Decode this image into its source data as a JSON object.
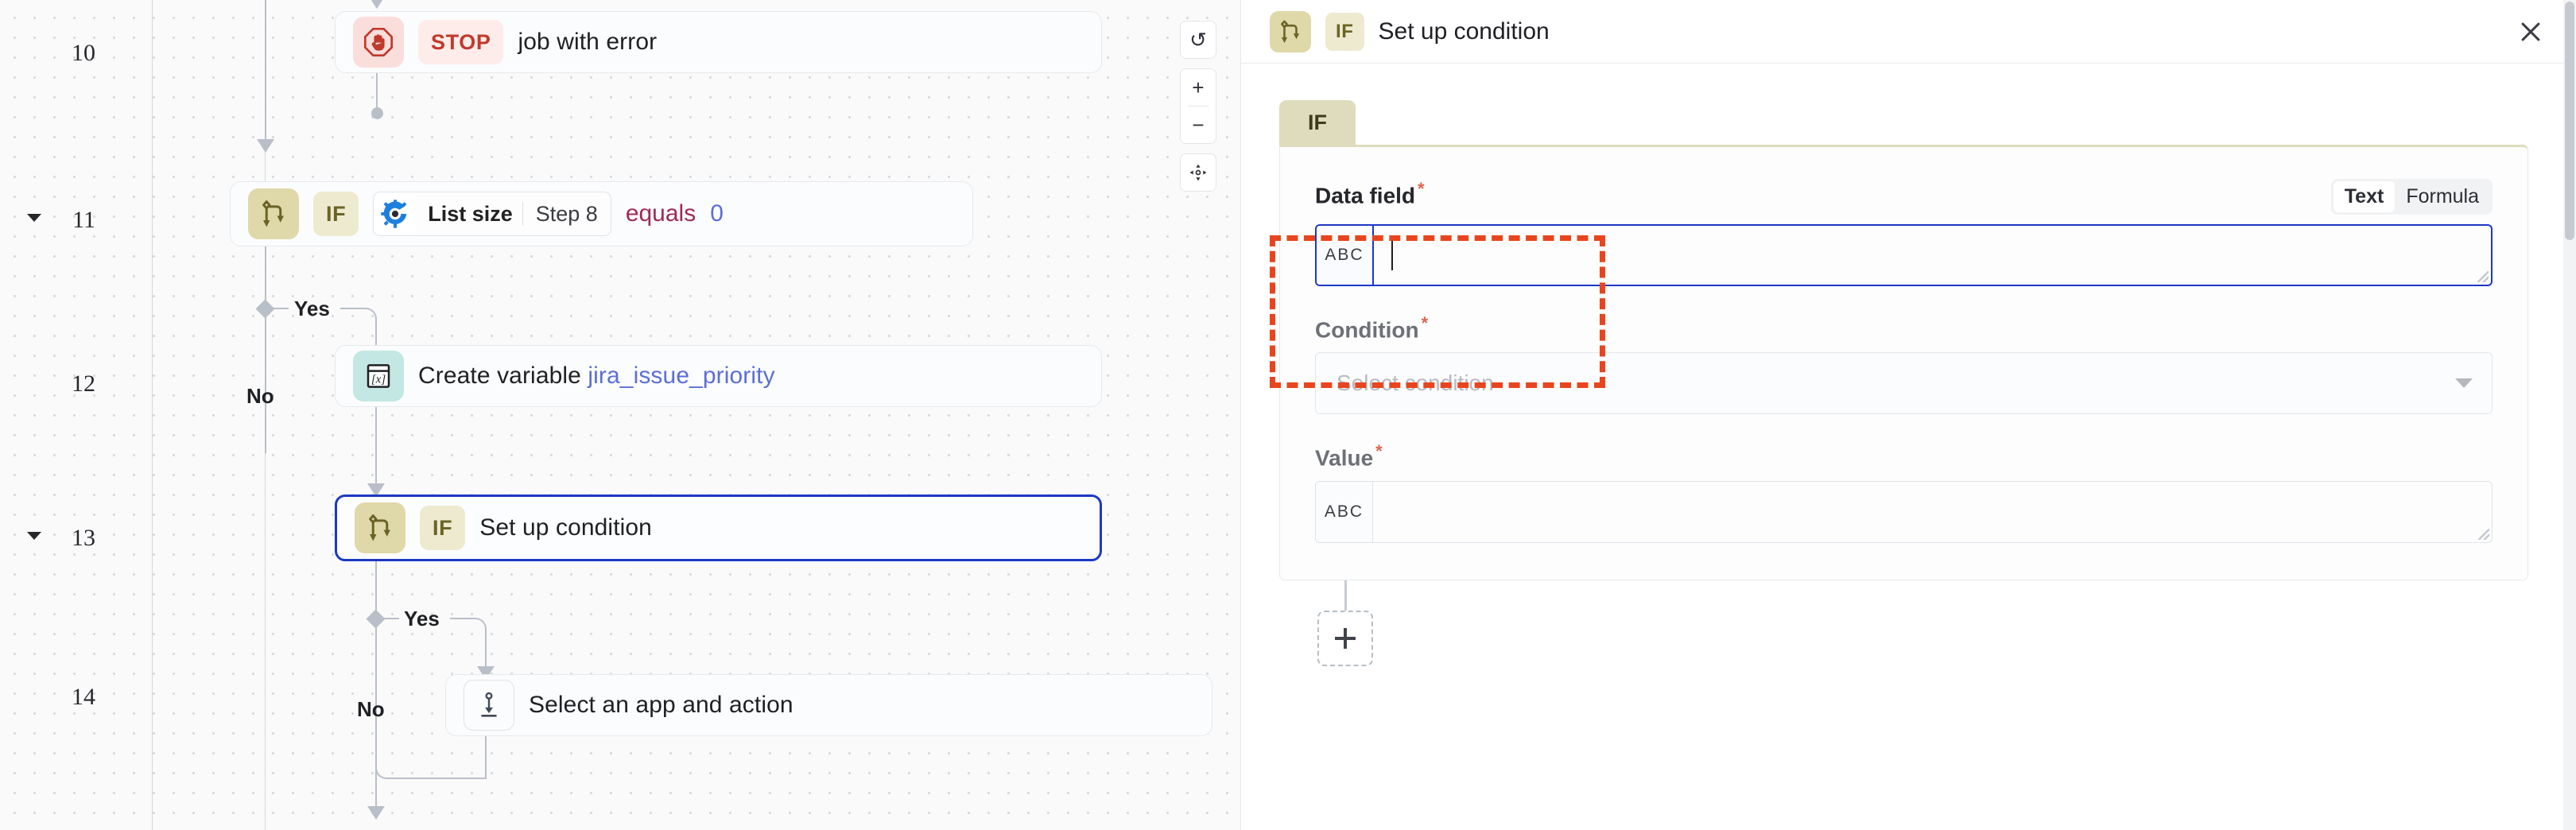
{
  "canvas": {
    "zoom_controls": {
      "undo_label": "↺",
      "zoom_in_label": "+",
      "zoom_out_label": "−",
      "fit_view_label": "✛"
    },
    "steps": [
      {
        "number": "10",
        "collapsible": false,
        "kind": "stop",
        "icon": "stop-hand-icon",
        "badge": "STOP",
        "title": "job with error"
      },
      {
        "number": "11",
        "collapsible": true,
        "kind": "condition",
        "icon": "branch-icon",
        "badge": "IF",
        "chip_icon": "gear-icon",
        "chip_primary": "List size",
        "chip_secondary": "Step 8",
        "operator": "equals",
        "operand": "0",
        "yes_label": "Yes",
        "no_label": "No"
      },
      {
        "number": "12",
        "collapsible": false,
        "kind": "variable",
        "icon": "variable-icon",
        "title_prefix": "Create variable ",
        "title_accent": "jira_issue_priority"
      },
      {
        "number": "13",
        "collapsible": true,
        "kind": "condition",
        "selected": true,
        "icon": "branch-icon",
        "badge": "IF",
        "title": "Set up condition",
        "yes_label": "Yes",
        "no_label": "No"
      },
      {
        "number": "14",
        "collapsible": false,
        "kind": "app",
        "icon": "app-action-icon",
        "title": "Select an app and action"
      }
    ]
  },
  "panel": {
    "header": {
      "icon": "branch-icon",
      "badge": "IF",
      "title": "Set up condition",
      "close_label": "✕"
    },
    "tabs": [
      {
        "label": "IF",
        "active": true
      }
    ],
    "fields": {
      "data_field": {
        "label": "Data field",
        "required_marker": "*",
        "prefix": "ABC",
        "value": "",
        "mode_options": [
          "Text",
          "Formula"
        ],
        "mode_selected": "Text",
        "focused": true,
        "annotated": true
      },
      "condition": {
        "label": "Condition",
        "required_marker": "*",
        "placeholder": "Select condition",
        "value": ""
      },
      "value": {
        "label": "Value",
        "required_marker": "*",
        "prefix": "ABC",
        "value": ""
      }
    },
    "add_step": {
      "label": "+"
    }
  },
  "colors": {
    "accent_blue": "#1c39c4",
    "annotation_red": "#e8451f",
    "branch_khaki": "#dfd8a8",
    "stop_red": "#c0392b",
    "variable_teal": "#c3e7e3",
    "link_blue": "#5b6fd4",
    "operator_magenta": "#9c2a58"
  }
}
